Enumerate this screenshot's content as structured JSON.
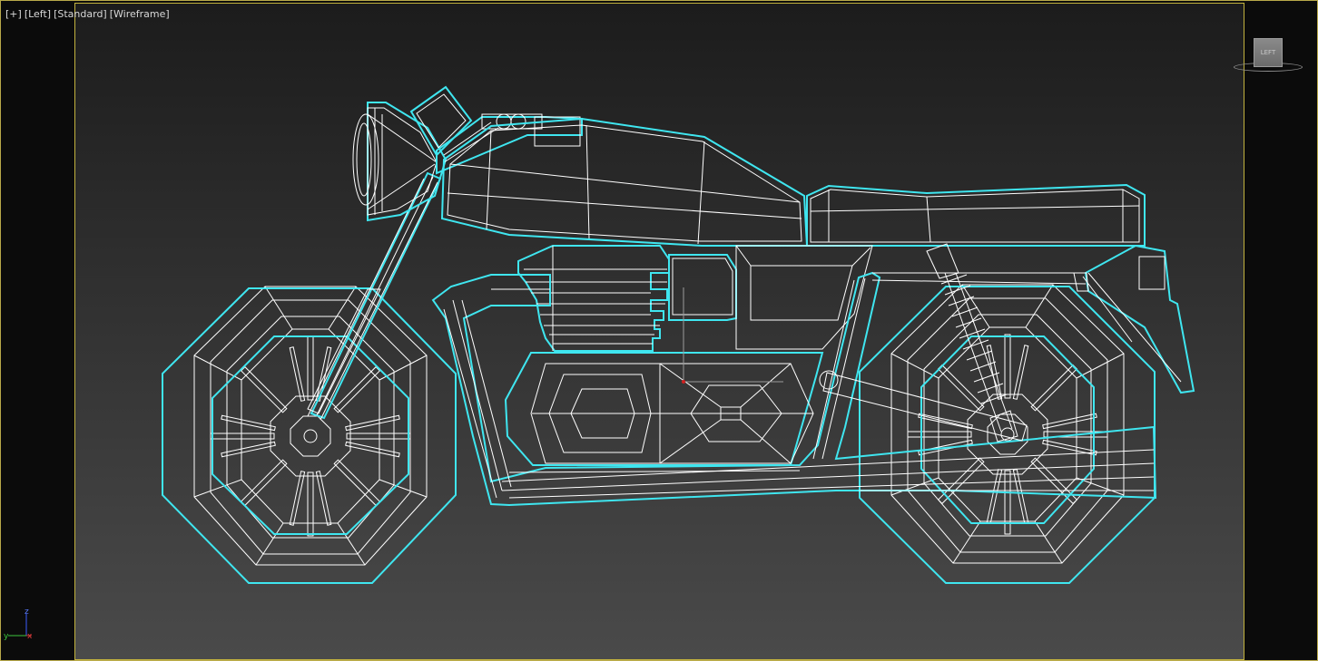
{
  "viewport": {
    "labels": [
      "[+]",
      "[Left]",
      "[Standard]",
      "[Wireframe]"
    ],
    "view_name": "Left",
    "frame_color": "#b8a94a",
    "selection_color": "#3fe6f0",
    "wire_color": "#ffffff"
  },
  "viewcube": {
    "face_label": "LEFT"
  },
  "axes": {
    "vertical": "z",
    "depth": "y",
    "horizontal": "x"
  }
}
